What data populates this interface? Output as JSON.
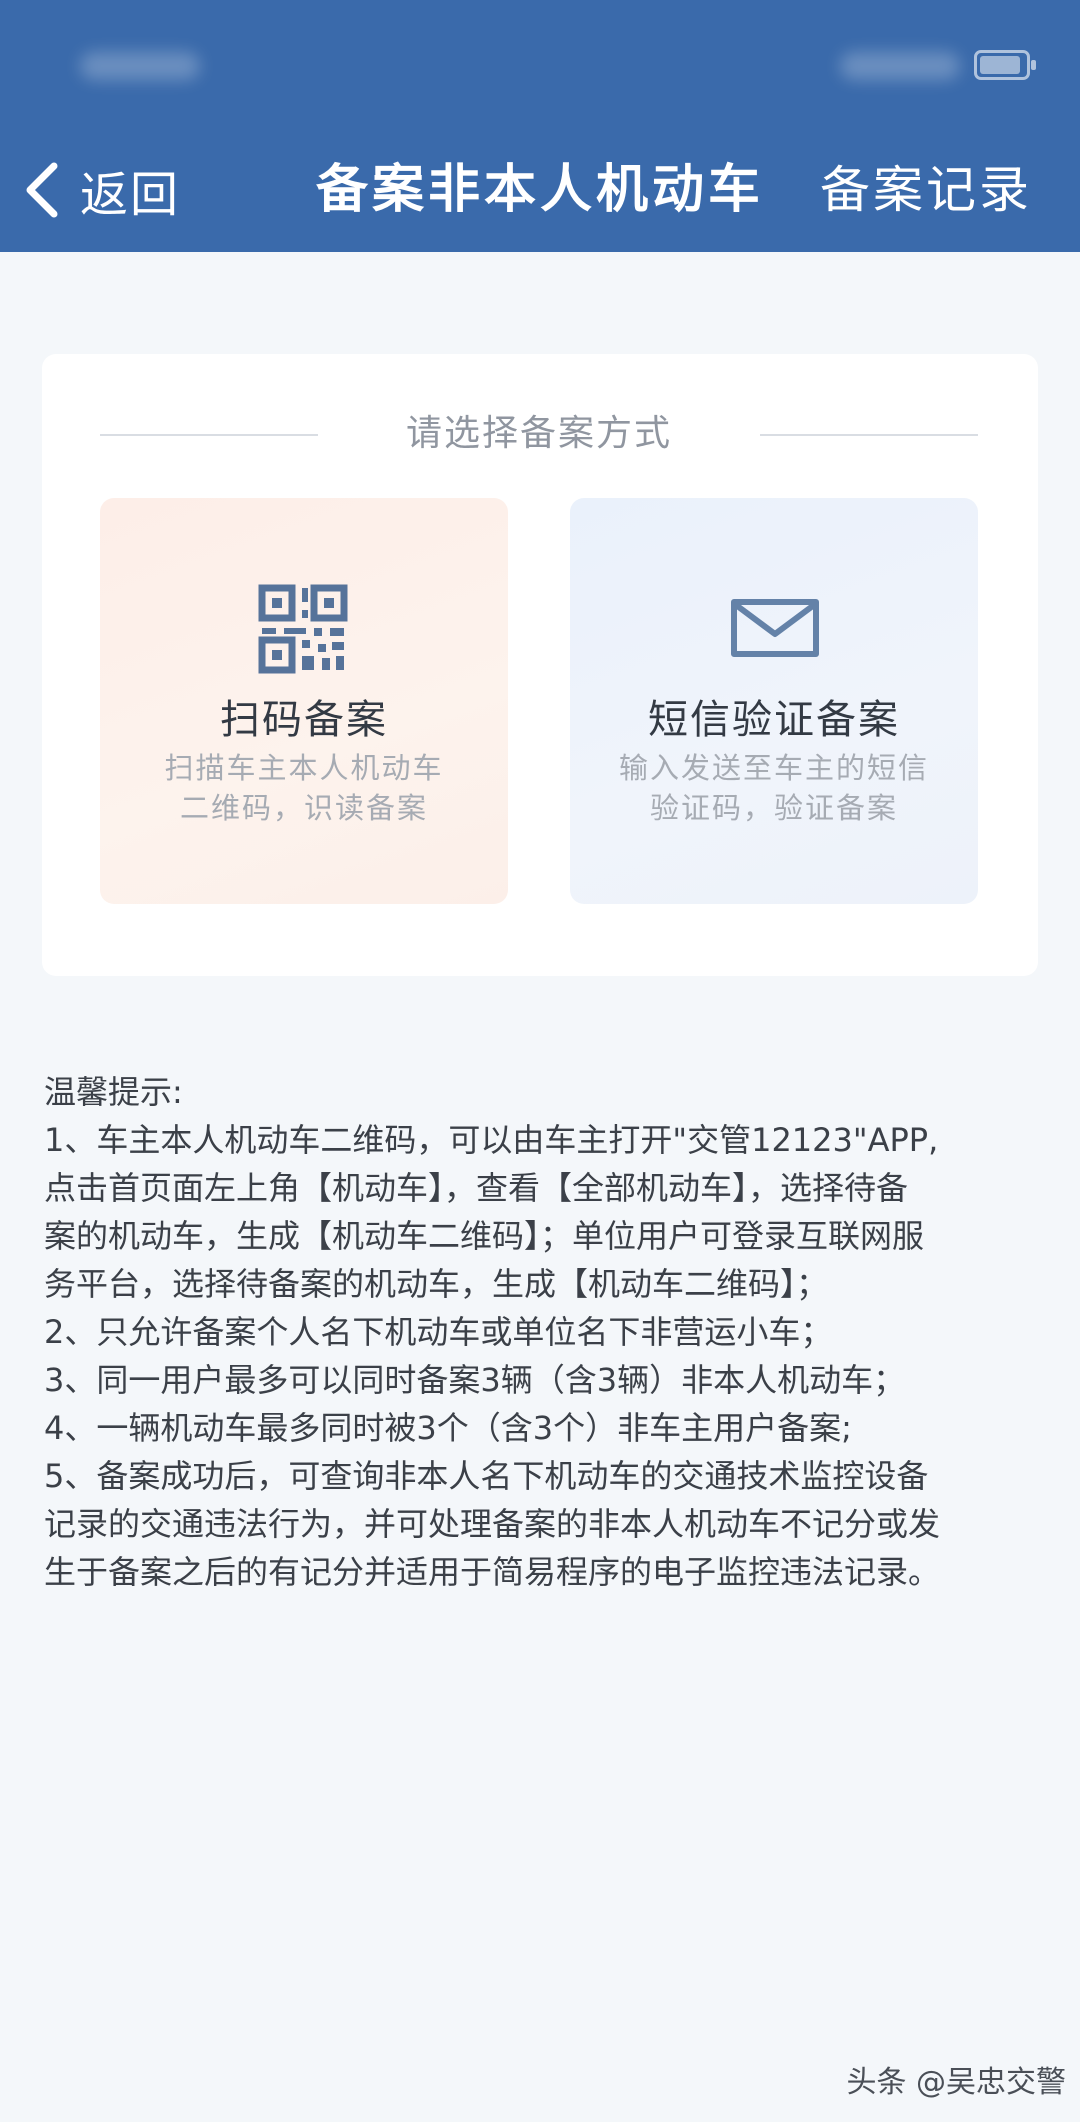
{
  "header": {
    "back_label": "返回",
    "title": "备案非本人机动车",
    "records_label": "备案记录",
    "background_color": "#3a6aab"
  },
  "method_card": {
    "heading": "请选择备案方式",
    "options": [
      {
        "icon": "qr-code-icon",
        "title": "扫码备案",
        "desc_line1": "扫描车主本人机动车",
        "desc_line2": "二维码，识读备案"
      },
      {
        "icon": "envelope-icon",
        "title": "短信验证备案",
        "desc_line1": "输入发送至车主的短信",
        "desc_line2": "验证码，验证备案"
      }
    ]
  },
  "tips": {
    "lines": [
      "温馨提示:",
      "1、车主本人机动车二维码，可以由车主打开\"交管12123\"APP,",
      "点击首页面左上角【机动车】，查看【全部机动车】，选择待备",
      "案的机动车，生成【机动车二维码】；单位用户可登录互联网服",
      "务平台，选择待备案的机动车，生成【机动车二维码】；",
      "2、只允许备案个人名下机动车或单位名下非营运小车；",
      "3、同一用户最多可以同时备案3辆（含3辆）非本人机动车；",
      "4、一辆机动车最多同时被3个（含3个）非车主用户备案;",
      "5、备案成功后，可查询非本人名下机动车的交通技术监控设备",
      "记录的交通违法行为，并可处理备案的非本人机动车不记分或发",
      "生于备案之后的有记分并适用于简易程序的电子监控违法记录。"
    ]
  },
  "watermark": "头条 @吴忠交警"
}
